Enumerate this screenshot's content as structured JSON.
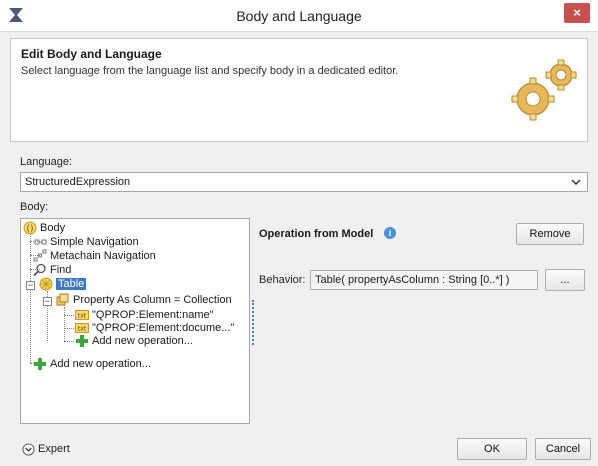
{
  "window": {
    "title": "Body and Language",
    "close_glyph": "×"
  },
  "header": {
    "title": "Edit Body and Language",
    "description": "Select language from the language list and specify body in a dedicated editor."
  },
  "language": {
    "label": "Language:",
    "value": "StructuredExpression"
  },
  "body": {
    "label": "Body:"
  },
  "tree": {
    "items": [
      {
        "label": "Body",
        "icon": "body-icon"
      },
      {
        "label": "Simple Navigation",
        "icon": "simple-navigation-icon"
      },
      {
        "label": "Metachain Navigation",
        "icon": "metachain-navigation-icon"
      },
      {
        "label": "Find",
        "icon": "find-icon"
      },
      {
        "label": "Table",
        "icon": "table-icon",
        "selected": true
      },
      {
        "label": "Property As Column = Collection",
        "icon": "collection-icon"
      },
      {
        "label": "\"QPROP:Element:name\"",
        "icon": "txt-icon",
        "icon_text": "txt"
      },
      {
        "label": "\"QPROP:Element:docume...\"",
        "icon": "txt-icon",
        "icon_text": "txt"
      },
      {
        "label": "Add new operation...",
        "icon": "add-icon"
      },
      {
        "label": "Add new operation...",
        "icon": "add-icon"
      }
    ]
  },
  "operation": {
    "title": "Operation from Model",
    "info_glyph": "i",
    "remove_label": "Remove",
    "behavior_label": "Behavior:",
    "behavior_value": "Table( propertyAsColumn : String [0..*] )",
    "browse_label": "..."
  },
  "footer": {
    "expert_label": "Expert",
    "ok_label": "OK",
    "cancel_label": "Cancel"
  },
  "colors": {
    "selection": "#3d79c6",
    "close_button": "#c75050",
    "add_icon": "#3fa33f",
    "info": "#4a90d9"
  }
}
